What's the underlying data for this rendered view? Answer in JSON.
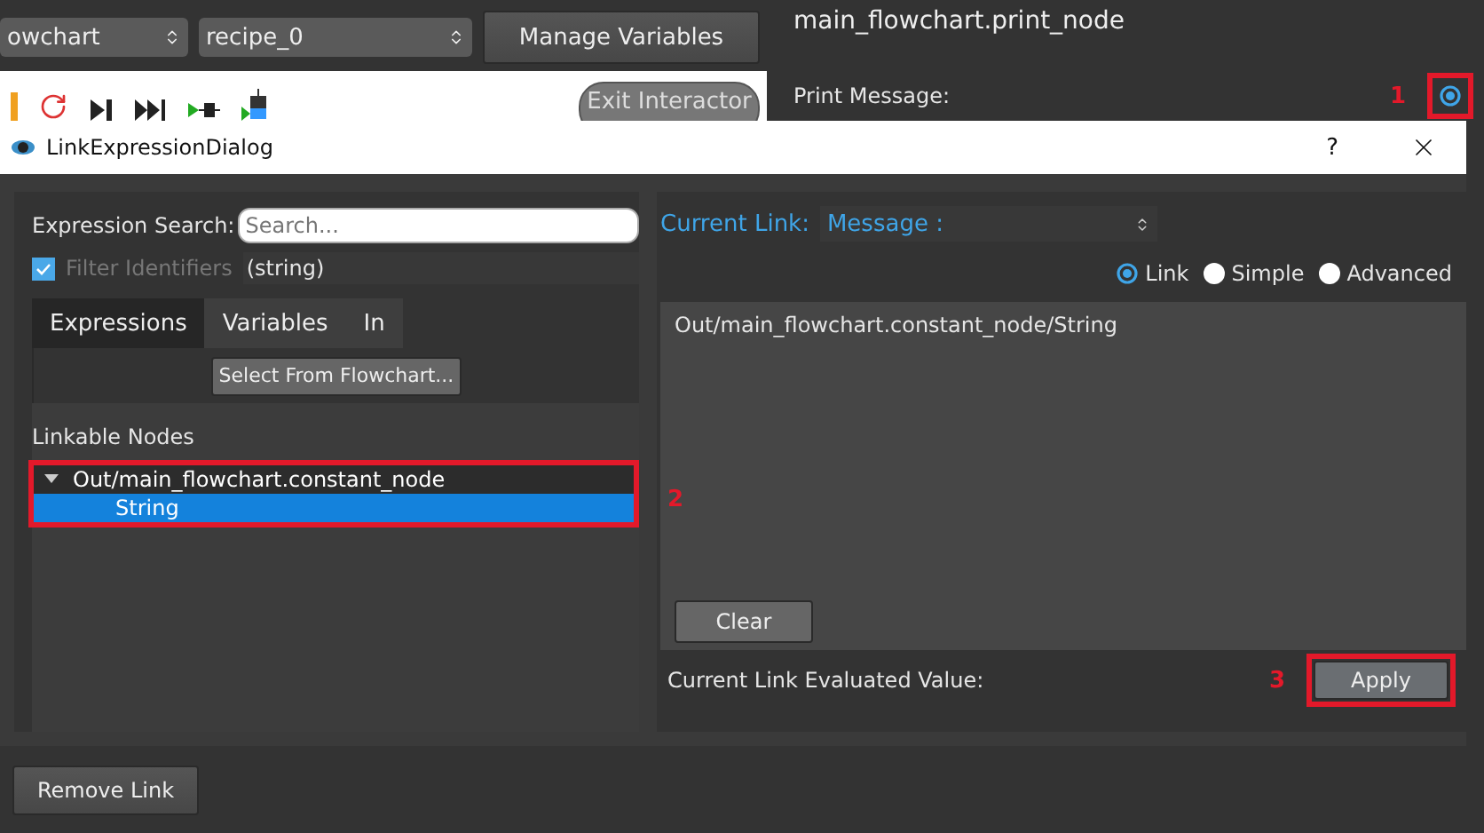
{
  "header": {
    "flowchart_select": "owchart",
    "recipe_select": "recipe_0",
    "manage_button": "Manage Variables",
    "node_title": "main_flowchart.print_node"
  },
  "toolbar": {
    "exit_button": "Exit Interactor"
  },
  "property": {
    "label": "Print Message:",
    "linked": true
  },
  "dialog": {
    "title": "LinkExpressionDialog",
    "help": "?",
    "search": {
      "label": "Expression Search:",
      "placeholder": "Search..."
    },
    "filter": {
      "label": "Filter Identifiers",
      "checked": true,
      "disabled": true,
      "type": "(string)"
    },
    "tabs": [
      {
        "label": "Expressions",
        "selected": true
      },
      {
        "label": "Variables",
        "selected": false
      },
      {
        "label": "In",
        "selected": false
      }
    ],
    "select_button": "Select From Flowchart...",
    "tree_title": "Linkable Nodes",
    "tree": [
      {
        "label": "Out/main_flowchart.constant_node",
        "expanded": true,
        "selected": false,
        "children": [
          {
            "label": "String",
            "selected": true
          }
        ]
      }
    ],
    "current_link": {
      "label": "Current Link:",
      "value": "Message :"
    },
    "modes": [
      {
        "label": "Link",
        "selected": true
      },
      {
        "label": "Simple",
        "selected": false
      },
      {
        "label": "Advanced",
        "selected": false
      }
    ],
    "expression": "Out/main_flowchart.constant_node/String",
    "clear_button": "Clear",
    "evaluated_label": "Current Link Evaluated Value:",
    "apply_button": "Apply"
  },
  "remove_button": "Remove Link",
  "annotations": [
    {
      "number": "1"
    },
    {
      "number": "2"
    },
    {
      "number": "3"
    }
  ]
}
